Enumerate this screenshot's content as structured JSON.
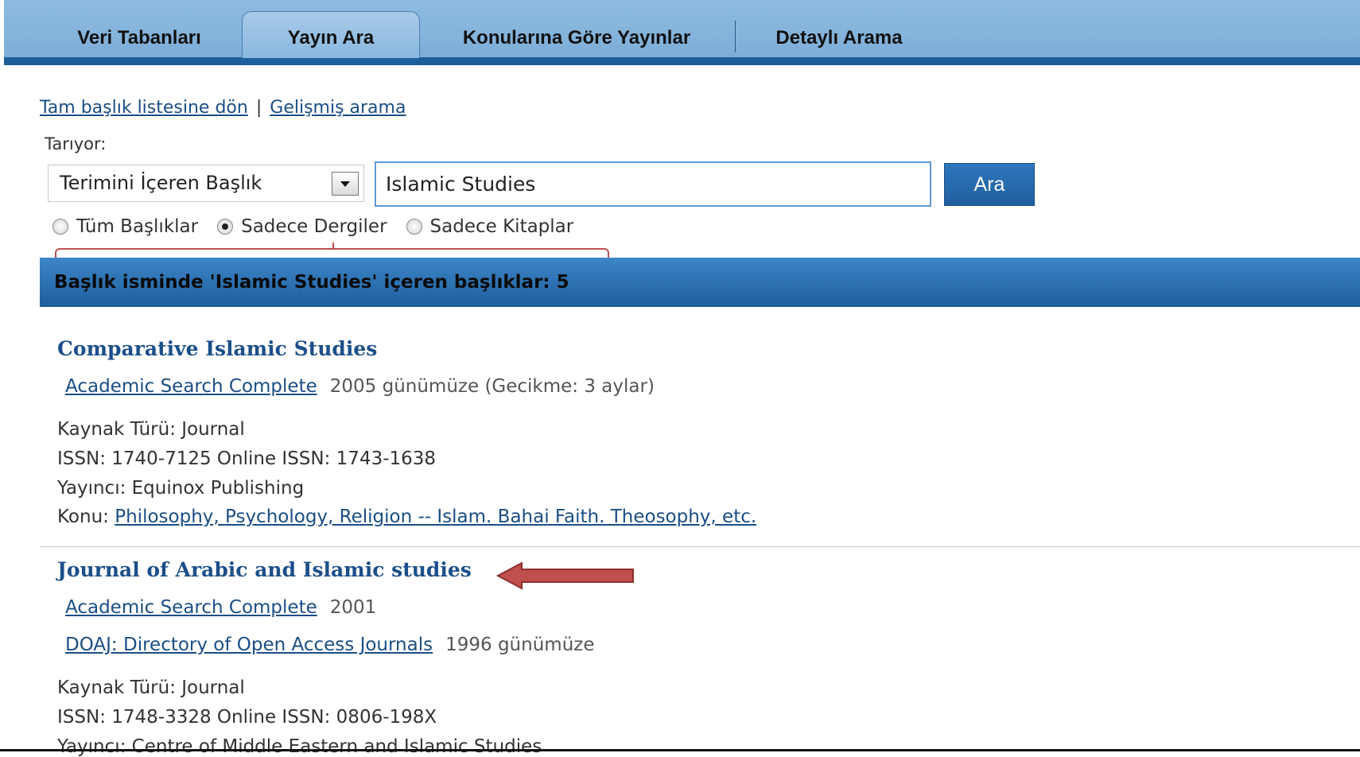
{
  "nav": {
    "tabs": [
      {
        "label": "Veri Tabanları"
      },
      {
        "label": "Yayın Ara",
        "active": true
      },
      {
        "label": "Konularına Göre Yayınlar"
      },
      {
        "label": "Detaylı Arama"
      }
    ]
  },
  "links": {
    "back_to_list": "Tam başlık listesine dön",
    "separator": "|",
    "advanced_search": "Gelişmiş arama"
  },
  "search": {
    "label": "Tarıyor:",
    "mode": "Terimini İçeren Başlık",
    "query": "Islamic Studies",
    "button": "Ara",
    "radios": [
      {
        "label": "Tüm Başlıklar",
        "checked": false
      },
      {
        "label": "Sadece Dergiler",
        "checked": true
      },
      {
        "label": "Sadece Kitaplar",
        "checked": false
      }
    ]
  },
  "results": {
    "header": "Başlık isminde 'Islamic Studies' içeren başlıklar: 5",
    "items": [
      {
        "title": "Comparative Islamic Studies",
        "databases": [
          {
            "name": "Academic Search Complete",
            "coverage": "2005 günümüze (Gecikme: 3 aylar)"
          }
        ],
        "source_type": "Kaynak Türü: Journal",
        "issn": "ISSN: 1740-7125 Online ISSN: 1743-1638",
        "publisher": "Yayıncı: Equinox Publishing",
        "subject_label": "Konu:",
        "subject": "Philosophy, Psychology, Religion -- Islam. Bahai Faith. Theosophy, etc."
      },
      {
        "title": "Journal of Arabic and Islamic studies",
        "databases": [
          {
            "name": "Academic Search Complete",
            "coverage": "2001"
          },
          {
            "name": "DOAJ: Directory of Open Access Journals",
            "coverage": "1996 günümüze"
          }
        ],
        "source_type": "Kaynak Türü: Journal",
        "issn": "ISSN: 1748-3328 Online ISSN: 0806-198X",
        "publisher": "Yayıncı: Centre of Middle Eastern and Islamic Studies"
      }
    ]
  },
  "colors": {
    "nav_bg": "#8fbbe0",
    "nav_bar": "#1d5f9b",
    "link": "#1a4e85",
    "annotation": "#c0504d"
  }
}
